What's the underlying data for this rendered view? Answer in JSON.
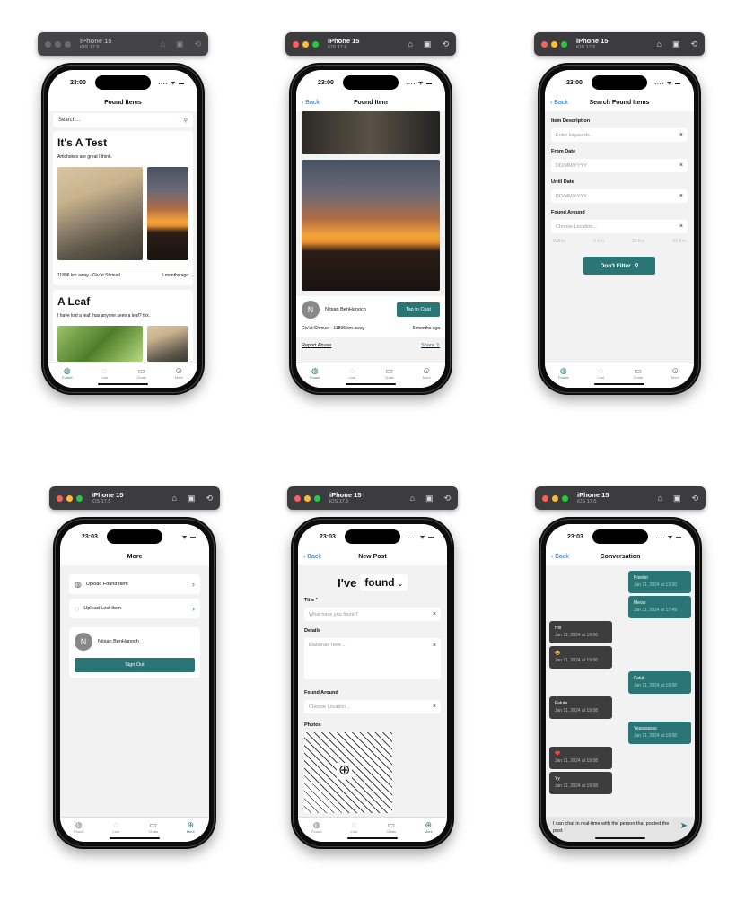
{
  "simulator": {
    "device": "iPhone 15",
    "os": "iOS 17.5"
  },
  "status": {
    "time_a": "23:00",
    "time_b": "23:03"
  },
  "tabs": {
    "found": "Found",
    "lost": "Lost",
    "chats": "Chats",
    "more": "More"
  },
  "s1": {
    "title": "Found Items",
    "search_placeholder": "Search...",
    "item1": {
      "title": "It's A Test",
      "desc": "Artichokes are great I think.",
      "distance": "11896 km away - Giv'at Shmuel",
      "age": "5 months ago"
    },
    "item2": {
      "title": "A Leaf",
      "desc": "I have lost a leaf. has anyone seen a leaf? thx."
    }
  },
  "s2": {
    "back": "Back",
    "title": "Found Item",
    "user": "Nitsan BenHanoch",
    "avatar": "N",
    "chat_btn": "Tap to Chat",
    "location": "Giv'at Shmuel - 11896 km away",
    "age": "5 months ago",
    "report": "Report Abuse",
    "share": "Share"
  },
  "s3": {
    "back": "Back",
    "title": "Search Found Items",
    "desc_label": "Item Description",
    "desc_ph": "Enter keywords...",
    "from_label": "From Date",
    "from_ph": "DD/MM/YYYY",
    "until_label": "Until Date",
    "until_ph": "DD/MM/YYYY",
    "around_label": "Found Around",
    "around_ph": "Choose Location...",
    "within": "Within",
    "km1": "5 Km",
    "km2": "15 Km",
    "km3": "50 Km",
    "filter_btn": "Don't Filter"
  },
  "s4": {
    "title": "More",
    "upload_found": "Upload Found Item",
    "upload_lost": "Upload Lost Item",
    "user": "Nitsan BenHanoch",
    "avatar": "N",
    "sign_out": "Sign Out"
  },
  "s5": {
    "back": "Back",
    "title": "New Post",
    "ive": "I've",
    "mode": "found",
    "title_label": "Title *",
    "title_ph": "What have you found?",
    "details_label": "Details",
    "details_ph": "Elaborate here...",
    "around_label": "Found Around",
    "around_ph": "Choose Location...",
    "photos_label": "Photos"
  },
  "s6": {
    "back": "Back",
    "title": "Conversation",
    "input": "I can chat in real-time with the person that posted the post",
    "messages": [
      {
        "text": "Poeder",
        "ts": "Jan 11, 2024 at 13:50"
      },
      {
        "text": "Meow",
        "ts": "Jan 11, 2024 at 17:49"
      },
      {
        "text": "Hiii",
        "ts": "Jan 11, 2024 at 19:06"
      },
      {
        "text": "😆",
        "ts": "Jan 11, 2024 at 19:06"
      },
      {
        "text": "Fatut",
        "ts": "Jan 11, 2024 at 19:08"
      },
      {
        "text": "Fatuta",
        "ts": "Jan 11, 2024 at 19:08"
      },
      {
        "text": "Yessssssss",
        "ts": "Jan 11, 2024 at 19:08"
      },
      {
        "text": "❤️",
        "ts": "Jan 11, 2024 at 19:08"
      },
      {
        "text": "Yy",
        "ts": "Jan 11, 2024 at 19:08"
      }
    ]
  }
}
